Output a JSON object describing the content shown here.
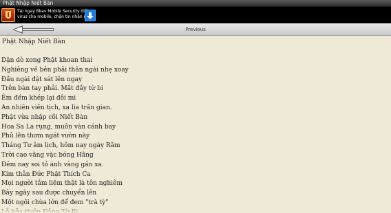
{
  "window": {
    "title": "Phật Nhập Niết Bàn"
  },
  "ad": {
    "icon": "bkav-shield-icon",
    "line1": "Tải ngay Bkav Mobile Security diệt",
    "line2": "virus cho mobile, chặn tin nhắn rác",
    "download_icon": "download-arrow-icon"
  },
  "nav": {
    "back_icon": "back-arrow-icon",
    "previous_label": "Previous"
  },
  "content": {
    "title": "Phật Nhập Niết Bàn",
    "lines": [
      "Dặn dò xong Phật khoan thai",
      "Nghiêng về bên phải thân ngài nhẹ xoay",
      "Đầu ngài đặt sát lên ngay",
      "Trên bàn tay phải. Mắt đầy từ bi",
      "Êm đềm khép lại đôi mi",
      "An nhiên viên tịch, xa lìa trần gian.",
      "Phật vừa nhập cõi Niết Bàn",
      "Hoa Sa La rụng, muôn vàn cánh bay",
      "Phủ lên thơm ngát vườn này",
      "Tháng Tư âm lịch, hôm nay ngày Rằm",
      "Trời cao vằng vặc bóng Hằng",
      "Đêm nay soi tỏ ánh vàng gần xa.",
      "Kim thân Đức Phật Thích Ca",
      "Mọi người tắm liệm thật là tôn nghiêm",
      "Bảy ngày sau được chuyển lên",
      "Một ngôi chùa lớn để đem \"trà tỳ\"",
      "Lễ hỏa thiêu Đảng Từ Bi"
    ]
  }
}
